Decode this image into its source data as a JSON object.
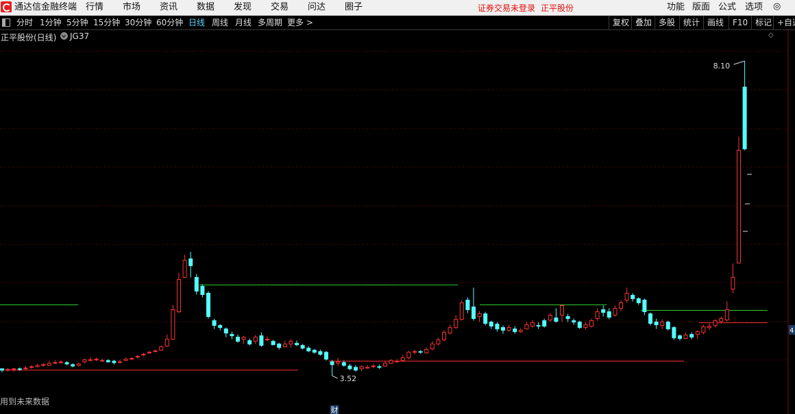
{
  "app": {
    "title": "通达信金融终端",
    "window_controls": "◎"
  },
  "menu": [
    "行情",
    "市场",
    "资讯",
    "数据",
    "发现",
    "交易",
    "问达",
    "圈子"
  ],
  "status": {
    "login_warning": "证券交易未登录",
    "stock_name": "正平股份"
  },
  "menu_right": [
    "功能",
    "版面",
    "公式",
    "选项"
  ],
  "periods": [
    "分时",
    "1分钟",
    "5分钟",
    "15分钟",
    "30分钟",
    "60分钟",
    "日线",
    "周线",
    "月线",
    "多周期",
    "更多 >"
  ],
  "active_period": "日线",
  "right_tools": [
    "复权",
    "叠加",
    "多股",
    "统计",
    "画线",
    "F10",
    "标记",
    "+自选"
  ],
  "chart": {
    "title": "正平股份(日线)",
    "indicator": "JG37",
    "high_label": "8.10",
    "low_label": "3.52",
    "event_badge": "财",
    "axis_badge": "4",
    "bottom_note": "用到未来数据"
  },
  "colors": {
    "up": "#ff3232",
    "down": "#54ffff",
    "support": "#ff3232",
    "resistance": "#30d030",
    "grid": "#7a1010",
    "background": "#000000"
  },
  "chart_data": {
    "type": "candlestick",
    "title": "正平股份(日线)",
    "y_range": [
      3.35,
      8.35
    ],
    "high": 8.1,
    "low": 3.52,
    "candles": [
      [
        3.62,
        3.6,
        3.62,
        3.57
      ],
      [
        3.61,
        3.61,
        3.63,
        3.58
      ],
      [
        3.61,
        3.62,
        3.63,
        3.58
      ],
      [
        3.62,
        3.61,
        3.64,
        3.59
      ],
      [
        3.63,
        3.63,
        3.66,
        3.61
      ],
      [
        3.64,
        3.65,
        3.67,
        3.62
      ],
      [
        3.65,
        3.67,
        3.69,
        3.64
      ],
      [
        3.67,
        3.68,
        3.7,
        3.65
      ],
      [
        3.67,
        3.7,
        3.73,
        3.66
      ],
      [
        3.71,
        3.71,
        3.74,
        3.69
      ],
      [
        3.72,
        3.72,
        3.74,
        3.69
      ],
      [
        3.71,
        3.69,
        3.73,
        3.67
      ],
      [
        3.68,
        3.66,
        3.7,
        3.64
      ],
      [
        3.67,
        3.69,
        3.71,
        3.65
      ],
      [
        3.72,
        3.75,
        3.77,
        3.7
      ],
      [
        3.75,
        3.75,
        3.79,
        3.74
      ],
      [
        3.76,
        3.76,
        3.78,
        3.73
      ],
      [
        3.74,
        3.74,
        3.77,
        3.73
      ],
      [
        3.74,
        3.72,
        3.76,
        3.71
      ],
      [
        3.73,
        3.71,
        3.75,
        3.68
      ],
      [
        3.72,
        3.72,
        3.75,
        3.7
      ],
      [
        3.74,
        3.76,
        3.78,
        3.73
      ],
      [
        3.76,
        3.77,
        3.79,
        3.75
      ],
      [
        3.79,
        3.8,
        3.82,
        3.77
      ],
      [
        3.82,
        3.83,
        3.85,
        3.8
      ],
      [
        3.86,
        3.86,
        3.88,
        3.84
      ],
      [
        3.87,
        3.88,
        3.9,
        3.86
      ],
      [
        3.89,
        3.94,
        3.96,
        3.88
      ],
      [
        3.95,
        4.05,
        4.12,
        3.94
      ],
      [
        4.05,
        4.48,
        4.55,
        4.04
      ],
      [
        4.45,
        4.92,
        5.02,
        4.43
      ],
      [
        4.95,
        5.2,
        5.28,
        4.94
      ],
      [
        5.22,
        5.12,
        5.32,
        4.95
      ],
      [
        4.95,
        4.75,
        5.0,
        4.7
      ],
      [
        4.82,
        4.7,
        4.85,
        4.66
      ],
      [
        4.72,
        4.38,
        4.75,
        4.35
      ],
      [
        4.32,
        4.25,
        4.35,
        4.2
      ],
      [
        4.25,
        4.22,
        4.27,
        4.18
      ],
      [
        4.2,
        4.14,
        4.22,
        4.08
      ],
      [
        4.12,
        4.1,
        4.16,
        4.05
      ],
      [
        4.08,
        4.02,
        4.12,
        4.0
      ],
      [
        4.05,
        4.08,
        4.1,
        3.98
      ],
      [
        4.03,
        3.98,
        4.06,
        3.96
      ],
      [
        4.02,
        4.08,
        4.11,
        3.98
      ],
      [
        4.1,
        3.96,
        4.15,
        3.94
      ],
      [
        4.05,
        4.05,
        4.09,
        4.02
      ],
      [
        4.02,
        3.97,
        4.04,
        3.96
      ],
      [
        3.98,
        3.93,
        4.0,
        3.9
      ],
      [
        3.94,
        3.98,
        4.03,
        3.93
      ],
      [
        3.98,
        4.02,
        4.05,
        3.93
      ],
      [
        3.99,
        3.97,
        4.03,
        3.95
      ],
      [
        3.96,
        3.92,
        3.98,
        3.9
      ],
      [
        3.92,
        3.88,
        3.95,
        3.86
      ],
      [
        3.89,
        3.86,
        3.91,
        3.84
      ],
      [
        3.87,
        3.83,
        3.9,
        3.81
      ],
      [
        3.86,
        3.76,
        3.88,
        3.74
      ],
      [
        3.72,
        3.68,
        3.75,
        3.52
      ],
      [
        3.7,
        3.72,
        3.78,
        3.66
      ],
      [
        3.71,
        3.67,
        3.74,
        3.65
      ],
      [
        3.66,
        3.62,
        3.69,
        3.6
      ],
      [
        3.64,
        3.6,
        3.67,
        3.58
      ],
      [
        3.62,
        3.65,
        3.67,
        3.59
      ],
      [
        3.64,
        3.64,
        3.67,
        3.62
      ],
      [
        3.65,
        3.66,
        3.69,
        3.63
      ],
      [
        3.65,
        3.64,
        3.68,
        3.62
      ],
      [
        3.66,
        3.7,
        3.73,
        3.65
      ],
      [
        3.7,
        3.74,
        3.76,
        3.69
      ],
      [
        3.73,
        3.73,
        3.76,
        3.71
      ],
      [
        3.74,
        3.78,
        3.82,
        3.73
      ],
      [
        3.78,
        3.86,
        3.88,
        3.76
      ],
      [
        3.86,
        3.87,
        3.9,
        3.83
      ],
      [
        3.87,
        3.86,
        3.89,
        3.84
      ],
      [
        3.85,
        3.9,
        3.93,
        3.84
      ],
      [
        3.91,
        3.98,
        4.02,
        3.89
      ],
      [
        3.98,
        4.04,
        4.07,
        3.96
      ],
      [
        4.04,
        4.15,
        4.18,
        4.02
      ],
      [
        4.14,
        4.22,
        4.26,
        4.12
      ],
      [
        4.22,
        4.34,
        4.4,
        4.2
      ],
      [
        4.34,
        4.58,
        4.62,
        4.32
      ],
      [
        4.62,
        4.48,
        4.66,
        4.43
      ],
      [
        4.52,
        4.35,
        4.8,
        4.32
      ],
      [
        4.38,
        4.42,
        4.46,
        4.3
      ],
      [
        4.42,
        4.28,
        4.45,
        4.25
      ],
      [
        4.3,
        4.24,
        4.32,
        4.2
      ],
      [
        4.27,
        4.2,
        4.3,
        4.16
      ],
      [
        4.22,
        4.18,
        4.25,
        4.13
      ],
      [
        4.18,
        4.22,
        4.26,
        4.16
      ],
      [
        4.2,
        4.16,
        4.24,
        4.13
      ],
      [
        4.16,
        4.18,
        4.21,
        4.14
      ],
      [
        4.2,
        4.26,
        4.3,
        4.19
      ],
      [
        4.24,
        4.29,
        4.33,
        4.22
      ],
      [
        4.25,
        4.24,
        4.3,
        4.2
      ],
      [
        4.32,
        4.24,
        4.35,
        4.22
      ],
      [
        4.33,
        4.4,
        4.43,
        4.3
      ],
      [
        4.36,
        4.31,
        4.5,
        4.29
      ],
      [
        4.4,
        4.54,
        4.56,
        4.3
      ],
      [
        4.38,
        4.35,
        4.42,
        4.3
      ],
      [
        4.32,
        4.3,
        4.35,
        4.26
      ],
      [
        4.3,
        4.22,
        4.32,
        4.2
      ],
      [
        4.22,
        4.26,
        4.3,
        4.19
      ],
      [
        4.24,
        4.32,
        4.35,
        4.22
      ],
      [
        4.35,
        4.45,
        4.5,
        4.32
      ],
      [
        4.48,
        4.44,
        4.54,
        4.38
      ],
      [
        4.45,
        4.37,
        4.5,
        4.34
      ],
      [
        4.4,
        4.5,
        4.54,
        4.38
      ],
      [
        4.5,
        4.58,
        4.62,
        4.46
      ],
      [
        4.62,
        4.72,
        4.8,
        4.58
      ],
      [
        4.69,
        4.64,
        4.72,
        4.6
      ],
      [
        4.64,
        4.58,
        4.66,
        4.55
      ],
      [
        4.62,
        4.45,
        4.64,
        4.4
      ],
      [
        4.42,
        4.28,
        4.44,
        4.25
      ],
      [
        4.3,
        4.26,
        4.35,
        4.2
      ],
      [
        4.25,
        4.3,
        4.34,
        4.2
      ],
      [
        4.3,
        4.2,
        4.32,
        4.18
      ],
      [
        4.22,
        4.07,
        4.24,
        4.04
      ],
      [
        4.1,
        4.06,
        4.12,
        4.03
      ],
      [
        4.06,
        4.11,
        4.15,
        4.05
      ],
      [
        4.12,
        4.08,
        4.15,
        4.05
      ],
      [
        4.12,
        4.16,
        4.18,
        4.05
      ],
      [
        4.15,
        4.23,
        4.26,
        4.12
      ],
      [
        4.22,
        4.24,
        4.28,
        4.18
      ],
      [
        4.25,
        4.32,
        4.34,
        4.22
      ],
      [
        4.31,
        4.35,
        4.38,
        4.28
      ],
      [
        4.33,
        4.48,
        4.6,
        4.31
      ],
      [
        4.78,
        4.95,
        5.15,
        4.72
      ],
      [
        5.16,
        6.8,
        7.0,
        5.15
      ],
      [
        7.72,
        6.82,
        8.1,
        6.8
      ]
    ],
    "horizontal_levels": [
      {
        "color": "resistance",
        "price": 4.84
      },
      {
        "color": "resistance",
        "price": 4.55
      },
      {
        "color": "resistance",
        "price": 4.55
      },
      {
        "color": "resistance",
        "price": 4.47
      },
      {
        "color": "support",
        "price": 3.6
      },
      {
        "color": "support",
        "price": 3.73
      },
      {
        "color": "support",
        "price": 4.29
      }
    ],
    "side_ticks": [
      6.45,
      6.02,
      5.62
    ]
  }
}
